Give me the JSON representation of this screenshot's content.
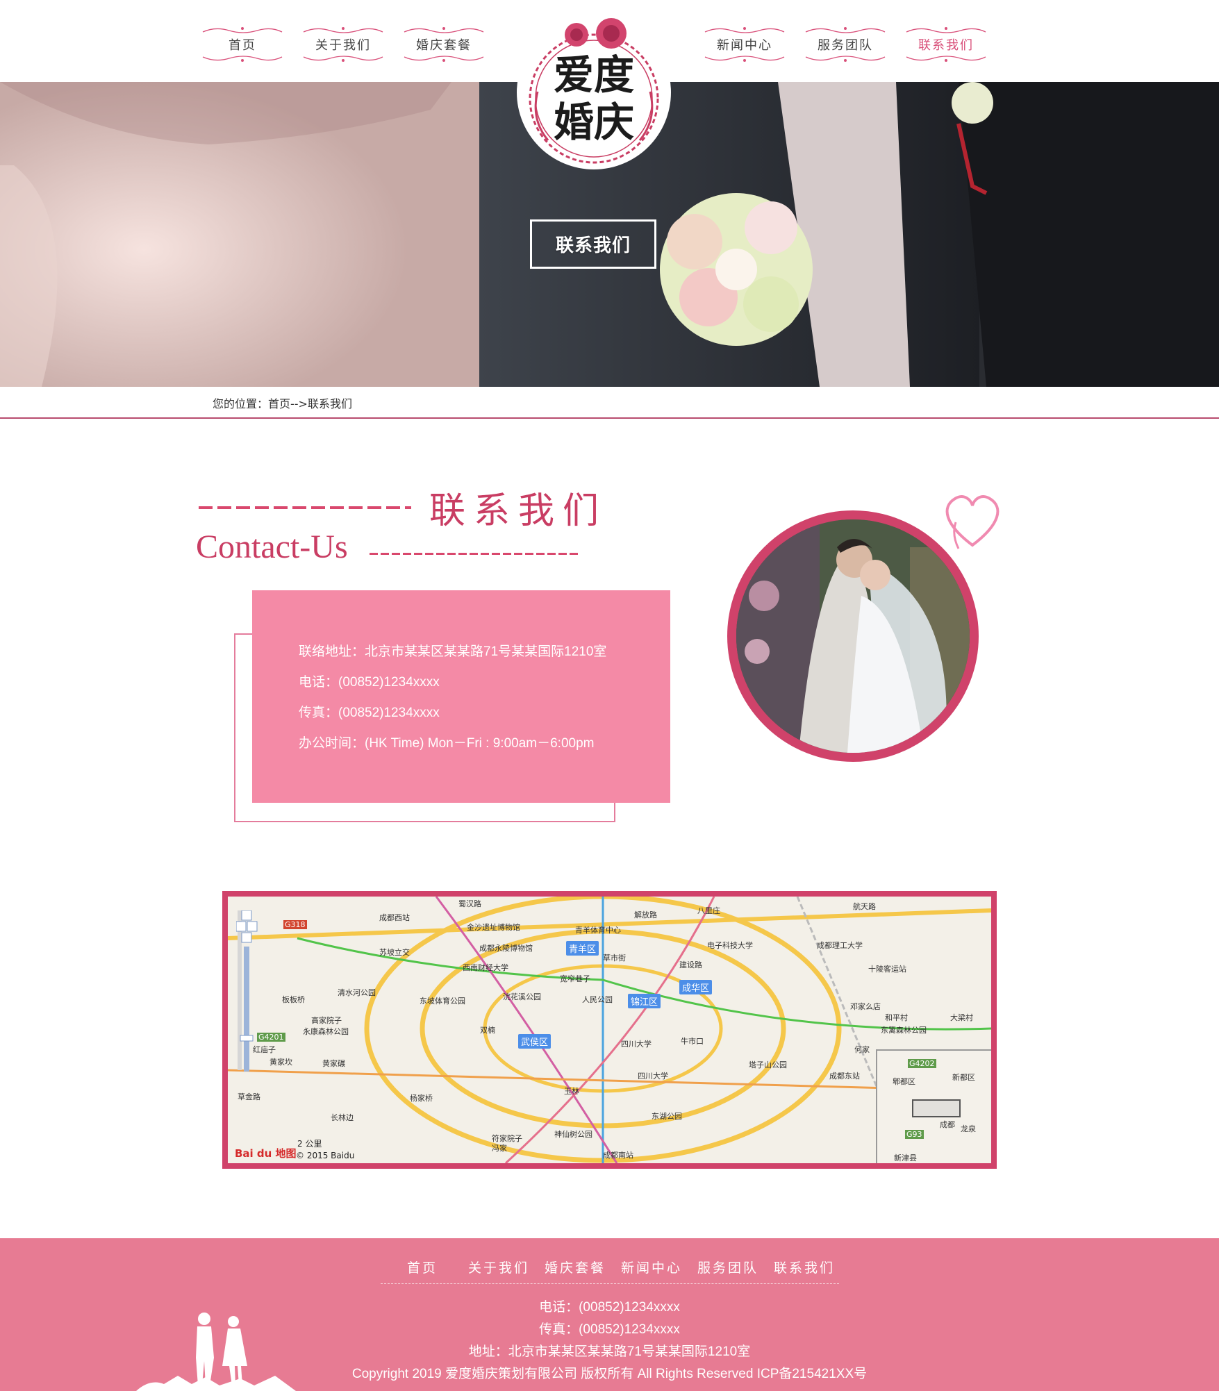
{
  "nav": {
    "left": [
      {
        "label": "首页"
      },
      {
        "label": "关于我们"
      },
      {
        "label": "婚庆套餐"
      }
    ],
    "right": [
      {
        "label": "新闻中心"
      },
      {
        "label": "服务团队"
      },
      {
        "label": "联系我们",
        "active": true
      }
    ]
  },
  "logo": {
    "line1": "爱度",
    "line2": "婚庆"
  },
  "hero": {
    "button_label": "联系我们"
  },
  "breadcrumb": {
    "text": "您的位置：首页-->联系我们"
  },
  "section": {
    "title_cn": "联系我们",
    "title_en": "Contact-Us"
  },
  "contact": {
    "address": "联络地址：北京市某某区某某路71号某某国际1210室",
    "phone": "电话：(00852)1234xxxx",
    "fax": "传真：(00852)1234xxxx",
    "hours": "办公时间：(HK Time) Mon－Fri : 9:00am－6:00pm"
  },
  "map": {
    "labels": [
      "蜀汉路",
      "成都西站",
      "金沙遗址博物馆",
      "青羊体育中心",
      "解放路",
      "八里庄",
      "航天路",
      "苏坡立交",
      "成都永陵博物馆",
      "青羊区",
      "草市街",
      "电子科技大学",
      "成都理工大学",
      "西南财经大学",
      "建设路",
      "十陵客运站",
      "宽窄巷子",
      "成华区",
      "清水河公园",
      "浣花溪公园",
      "人民公园",
      "锦江区",
      "板板桥",
      "东坡体育公园",
      "邓家么店",
      "和平村",
      "大梁村",
      "高家院子",
      "永康森林公园",
      "双楠",
      "武侯区",
      "牛市口",
      "东篱森林公园",
      "红庙子",
      "黄家坎",
      "四川大学",
      "何家",
      "黄家碾",
      "塔子山公园",
      "成都东站",
      "四川大学",
      "玉林",
      "草金路",
      "长林边",
      "东湖公园",
      "杨家桥",
      "神仙树公园",
      "符家院子",
      "冯家",
      "成都南站",
      "G4201",
      "G318",
      "G4202",
      "G93",
      "郫都区",
      "新都区",
      "成都",
      "新津县",
      "龙泉"
    ],
    "scale": "2 公里",
    "attribution": "© 2015 Baidu",
    "logo": "Bai du 地图"
  },
  "footer": {
    "nav": [
      "首页",
      "关于我们",
      "婚庆套餐",
      "新闻中心",
      "服务团队",
      "联系我们"
    ],
    "phone": "电话：(00852)1234xxxx",
    "fax": "传真：(00852)1234xxxx",
    "address": "地址：北京市某某区某某路71号某某国际1210室",
    "copyright": "Copyright 2019 爱度婚庆策划有限公司 版权所有 All Rights Reserved ICP备215421XX号"
  },
  "colors": {
    "accent": "#d0426a",
    "card": "#f48aa6",
    "footer": "#e77b93",
    "breadcrumb_rule": "#b84b6d"
  }
}
